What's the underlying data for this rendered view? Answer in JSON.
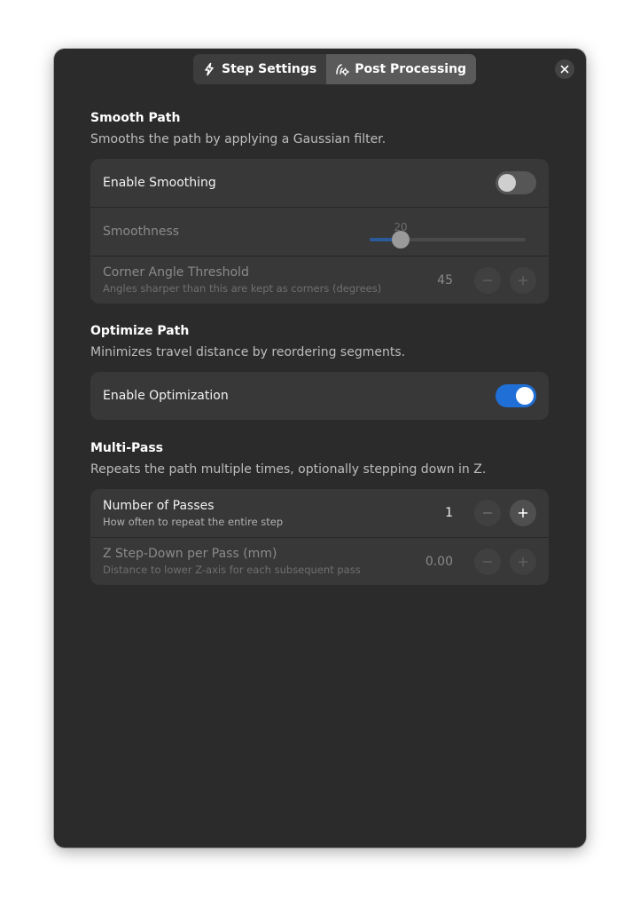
{
  "header": {
    "tabs": [
      {
        "label": "Step Settings",
        "icon": "bolt-icon"
      },
      {
        "label": "Post Processing",
        "icon": "tune-icon"
      }
    ],
    "active_tab": "Post Processing",
    "close_icon": "close-icon"
  },
  "smooth_path": {
    "title": "Smooth Path",
    "description": "Smooths the path by applying a Gaussian filter.",
    "enable_label": "Enable Smoothing",
    "enabled": false,
    "smoothness_label": "Smoothness",
    "smoothness_value": "20",
    "corner_label": "Corner Angle Threshold",
    "corner_sub": "Angles sharper than this are kept as corners (degrees)",
    "corner_value": "45"
  },
  "optimize_path": {
    "title": "Optimize Path",
    "description": "Minimizes travel distance by reordering segments.",
    "enable_label": "Enable Optimization",
    "enabled": true
  },
  "multi_pass": {
    "title": "Multi-Pass",
    "description": "Repeats the path multiple times, optionally stepping down in Z.",
    "passes_label": "Number of Passes",
    "passes_sub": "How often to repeat the entire step",
    "passes_value": "1",
    "stepdown_label": "Z Step-Down per Pass (mm)",
    "stepdown_sub": "Distance to lower Z-axis for each subsequent pass",
    "stepdown_value": "0.00"
  },
  "colors": {
    "window_bg": "#2b2b2b",
    "card_bg": "#383838",
    "accent": "#1f6fd6"
  }
}
